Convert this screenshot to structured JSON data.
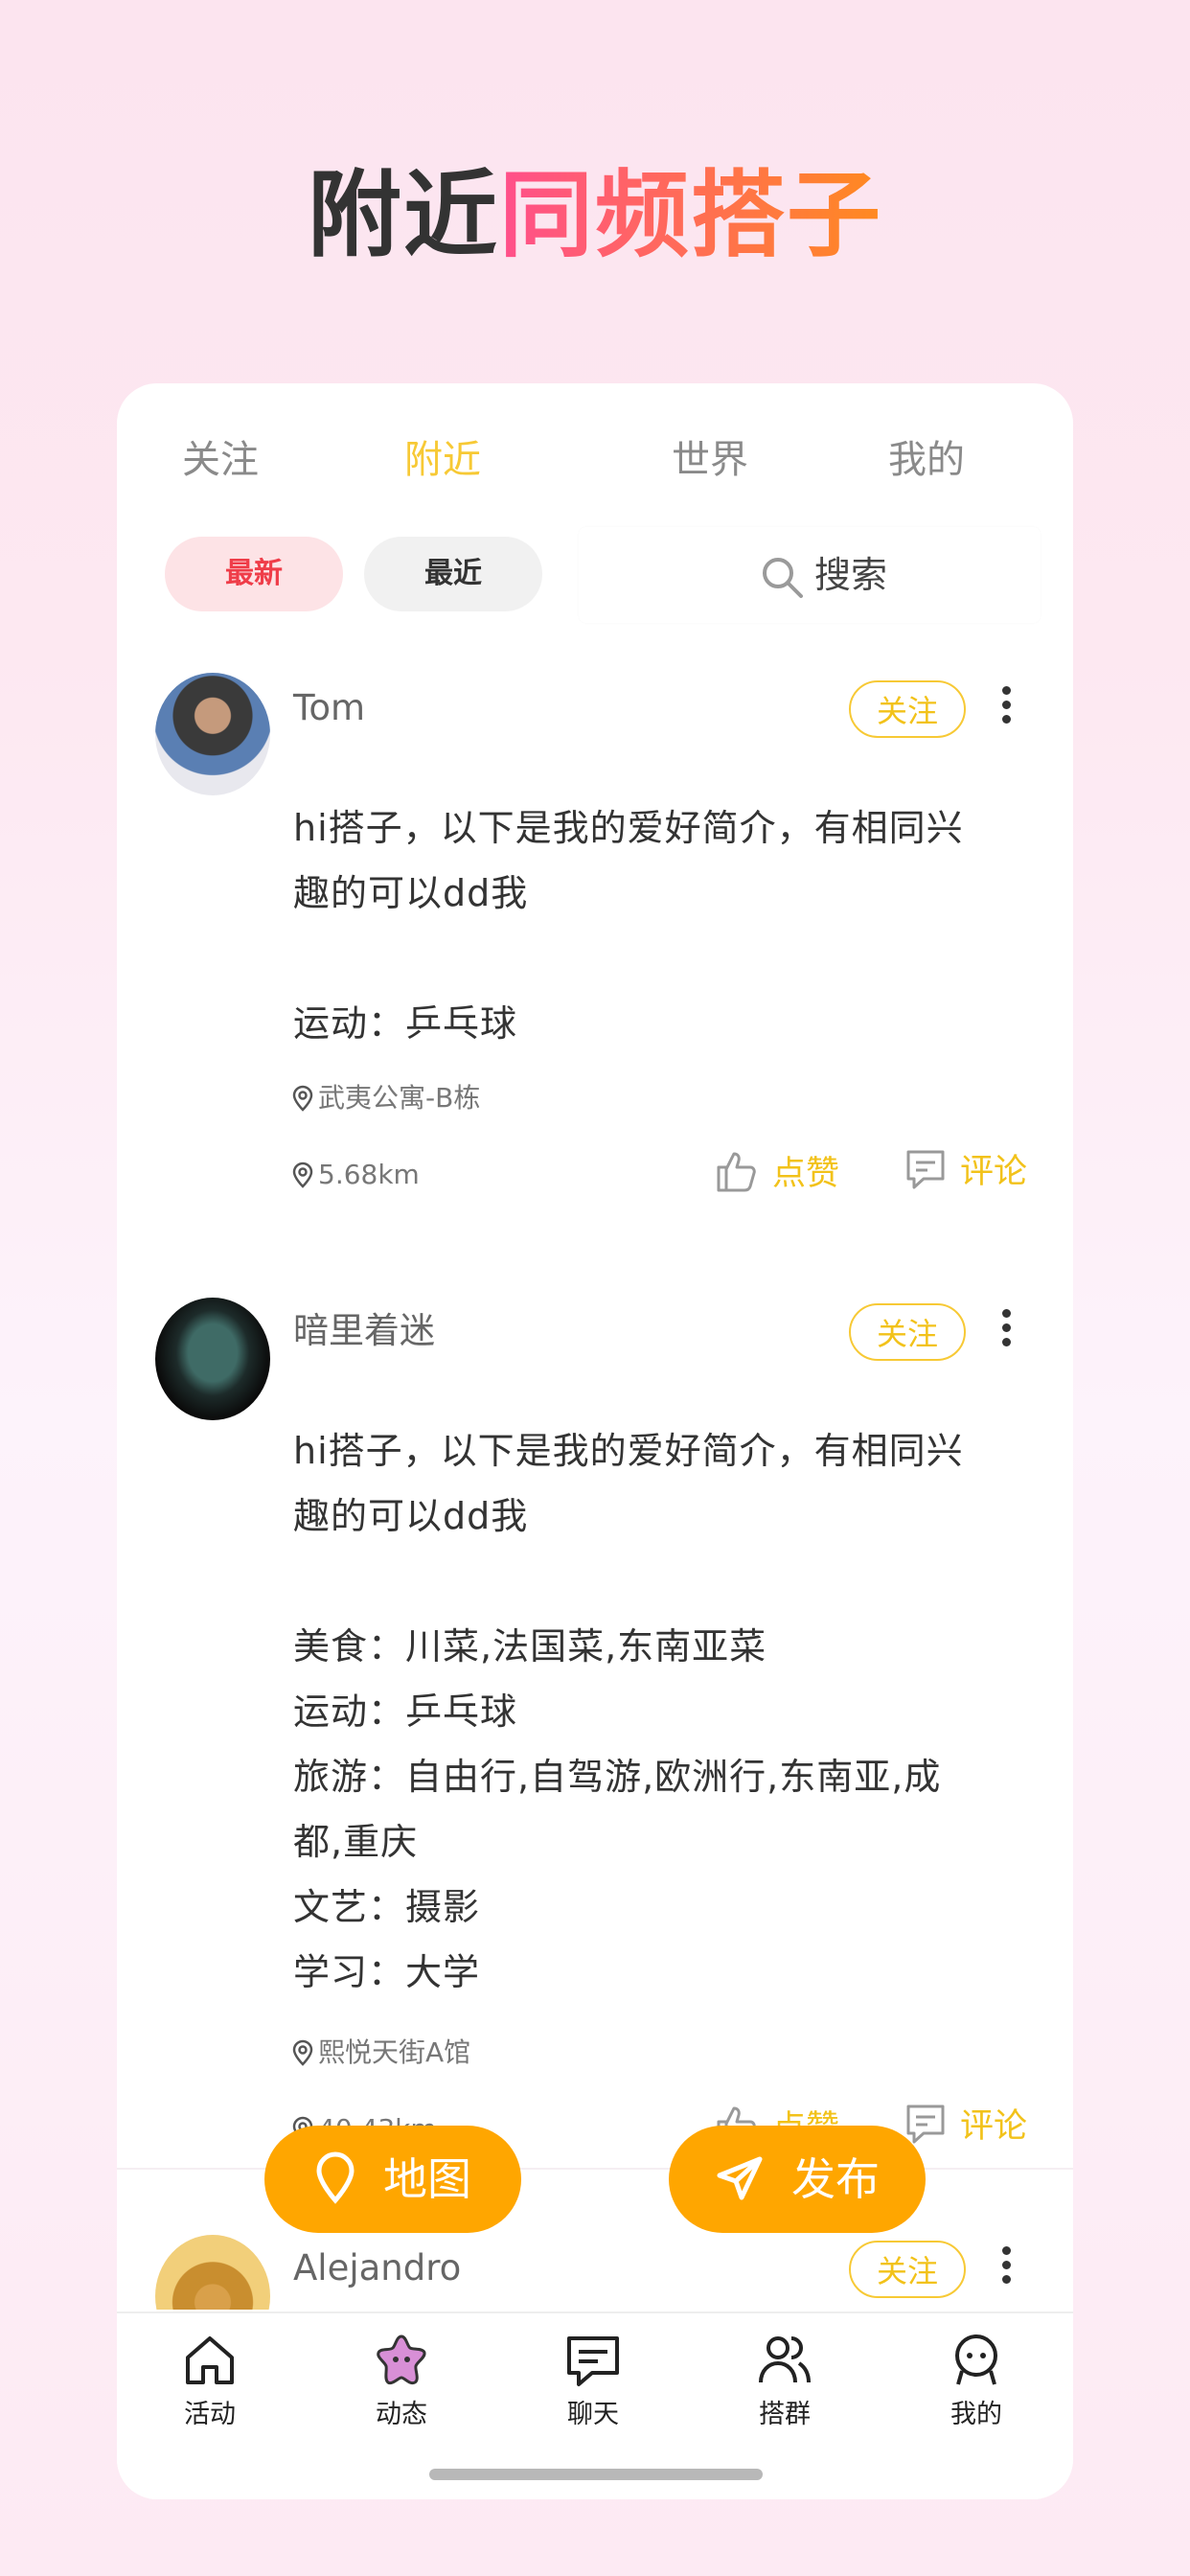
{
  "headline": {
    "part1": "附近",
    "part2": "同频搭子"
  },
  "tabs": [
    {
      "label": "关注",
      "active": false
    },
    {
      "label": "附近",
      "active": true
    },
    {
      "label": "世界",
      "active": false
    },
    {
      "label": "我的",
      "active": false
    }
  ],
  "filters": {
    "newest": "最新",
    "recent": "最近"
  },
  "search": {
    "placeholder": "搜索"
  },
  "posts": [
    {
      "username": "Tom",
      "follow_label": "关注",
      "text": "hi搭子，以下是我的爱好简介，有相同兴\n趣的可以dd我\n\n运动：乒乓球",
      "location": "武夷公寓-B栋",
      "distance": "5.68km",
      "like_label": "点赞",
      "comment_label": "评论"
    },
    {
      "username": "暗里着迷",
      "follow_label": "关注",
      "text": "hi搭子，以下是我的爱好简介，有相同兴\n趣的可以dd我\n\n美食：川菜,法国菜,东南亚菜\n运动：乒乓球\n旅游：自由行,自驾游,欧洲行,东南亚,成\n都,重庆\n文艺：摄影\n学习：大学",
      "location": "熙悦天街A馆",
      "distance": "40.43km",
      "like_label": "点赞",
      "comment_label": "评论"
    },
    {
      "username": "Alejandro",
      "follow_label": "关注"
    }
  ],
  "fabs": {
    "map": "地图",
    "publish": "发布"
  },
  "bottom_nav": [
    {
      "label": "活动",
      "icon": "home-icon"
    },
    {
      "label": "动态",
      "icon": "star-icon"
    },
    {
      "label": "聊天",
      "icon": "chat-icon"
    },
    {
      "label": "搭群",
      "icon": "group-icon"
    },
    {
      "label": "我的",
      "icon": "profile-icon"
    }
  ],
  "colors": {
    "accent": "#f7c935",
    "fab": "#ffa600",
    "chip_red": "#ef3d49",
    "headline_gradient": [
      "#ff4f8b",
      "#ff8a1f"
    ]
  }
}
